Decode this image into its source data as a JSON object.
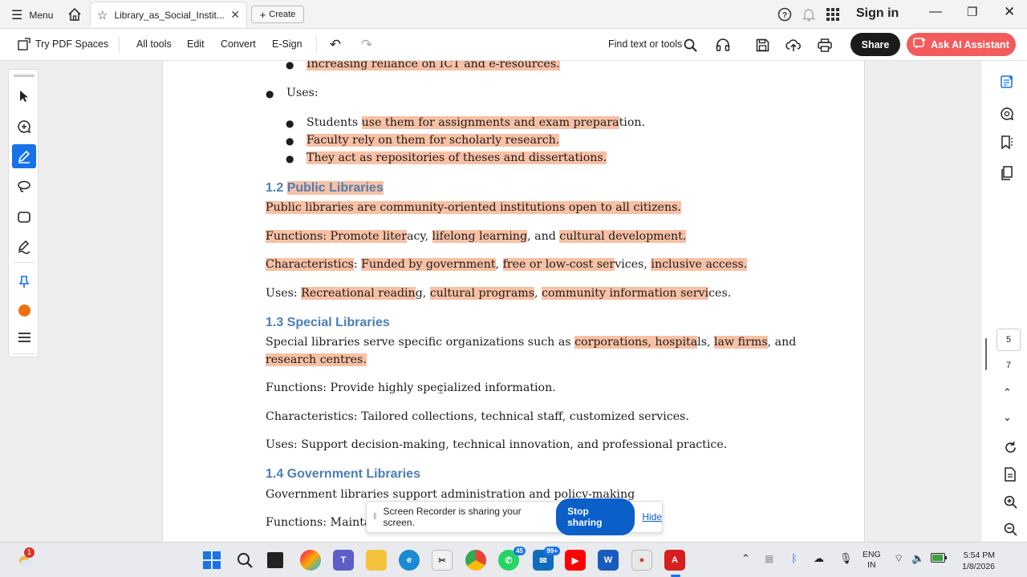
{
  "titlebar": {
    "menu_label": "Menu",
    "tab_title": "Library_as_Social_Instit...",
    "create_label": "Create",
    "sign_in": "Sign in"
  },
  "toolbar": {
    "try_pdf_spaces": "Try PDF Spaces",
    "all_tools": "All tools",
    "edit": "Edit",
    "convert": "Convert",
    "esign": "E-Sign",
    "find": "Find text or tools",
    "share": "Share",
    "ask_ai": "Ask AI Assistant"
  },
  "doc": {
    "top_partial": "Increasing reliance on ICT and e-resources.",
    "uses_label": "Uses:",
    "uses_items": [
      {
        "pre": "Students ",
        "hl": "use them for assignments and exam prepara",
        "post": "tion."
      },
      {
        "pre": "",
        "hl": "Faculty rely on them for scholarly research.",
        "post": ""
      },
      {
        "pre": "",
        "hl": "They act as repositories of theses and dissertations.",
        "post": ""
      }
    ],
    "sec12": {
      "num": "1.2 ",
      "title": "Public Libraries",
      "def": "Public libraries are community-oriented institutions open to all citizens.",
      "functions": {
        "a": "Functions: Promote liter",
        "b": "acy, ",
        "c": "lifelong learning",
        "d": ", and ",
        "e": "cultural development."
      },
      "characteristics": {
        "a": "Characteristics",
        "b": ": ",
        "c": "Funded by government",
        "d": ", ",
        "e": "free or low-cost ser",
        "f": "vices",
        "g": ", ",
        "h": "inclusive access."
      },
      "uses": {
        "a": "Uses: ",
        "b": "Recreational readin",
        "c": "g, ",
        "d": "cultural programs",
        "e": ", ",
        "f": "community information servi",
        "g": "ces."
      }
    },
    "sec13": {
      "title": "1.3 Special Libraries",
      "def_a": "Special libraries serve specific organizations such as ",
      "def_b": "corporations, hospita",
      "def_c": "ls, ",
      "def_d": "law firms",
      "def_e": ", and",
      "def_line2": "research centres.",
      "functions": "Functions: Provide highly specialized information.",
      "characteristics": "Characteristics: Tailored collections, technical staff, customized services.",
      "uses": "Uses: Support decision-making, technical innovation, and professional practice."
    },
    "sec14": {
      "title": "1.4 Government Libraries",
      "def": "Government libraries support administration and policy-making",
      "functions_partial": "Functions: Maintai"
    }
  },
  "sharebar": {
    "message": "Screen Recorder is sharing your screen.",
    "stop": "Stop sharing",
    "hide": "Hide"
  },
  "pager": {
    "current": "5",
    "total": "7"
  },
  "taskbar": {
    "notif_badge": "1",
    "whatsapp_badge": "45",
    "mail_badge": "99+",
    "lang": "ENG",
    "region": "IN",
    "time": "5:54 PM",
    "date": "1/8/2026"
  },
  "colors": {
    "highlight": "#f8c0a4",
    "heading": "#4a7fb5",
    "ai_button": "#f25c5c",
    "stop_button": "#0a5fc8"
  }
}
